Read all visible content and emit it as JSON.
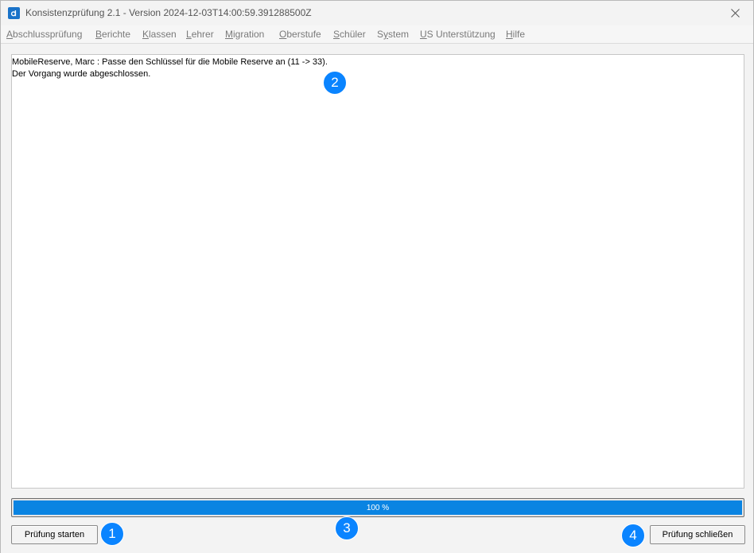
{
  "window": {
    "title": "Konsistenzprüfung 2.1 - Version 2024-12-03T14:00:59.391288500Z",
    "app_icon": "a",
    "close_icon": "close-icon"
  },
  "menu": [
    {
      "pre": "",
      "mn": "A",
      "post": "bschlussprüfung"
    },
    {
      "pre": "",
      "mn": "B",
      "post": "erichte"
    },
    {
      "pre": "",
      "mn": "K",
      "post": "lassen"
    },
    {
      "pre": "",
      "mn": "L",
      "post": "ehrer"
    },
    {
      "pre": "",
      "mn": "M",
      "post": "igration"
    },
    {
      "pre": "",
      "mn": "O",
      "post": "berstufe"
    },
    {
      "pre": "",
      "mn": "S",
      "post": "chüler"
    },
    {
      "pre": "S",
      "mn": "y",
      "post": "stem"
    },
    {
      "pre": "",
      "mn": "U",
      "post": "S Unterstützung"
    },
    {
      "pre": "",
      "mn": "H",
      "post": "ilfe"
    }
  ],
  "log": {
    "lines": [
      "MobileReserve, Marc : Passe den Schlüssel für die Mobile Reserve an (11 -> 33).",
      "Der Vorgang wurde abgeschlossen."
    ]
  },
  "progress": {
    "value": 1.0,
    "label": "100 %",
    "color": "#0a84e2"
  },
  "buttons": {
    "start": "Prüfung starten",
    "close": "Prüfung schließen"
  },
  "markers": [
    "1",
    "2",
    "3",
    "4"
  ]
}
